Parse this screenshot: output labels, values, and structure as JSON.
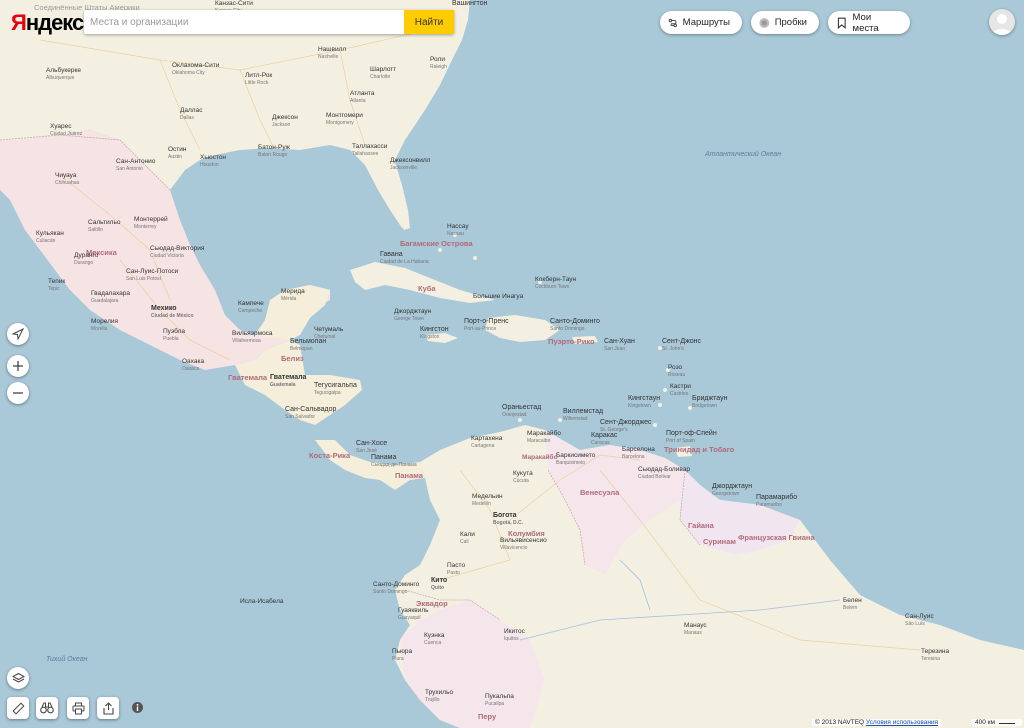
{
  "logo": {
    "first": "Я",
    "rest": "ндекс"
  },
  "search": {
    "placeholder": "Места и организации",
    "button": "Найти"
  },
  "toolbar": {
    "routes": "Маршруты",
    "traffic": "Пробки",
    "places": "Мои места"
  },
  "copyright": {
    "text": "© 2013 NAVTEQ",
    "link": "Условия использования"
  },
  "scale": {
    "label": "400 км"
  },
  "colors": {
    "sea": "#a9c8d8",
    "land": "#f5f1e3",
    "mexico": "#f6e4e4",
    "yellow": "#ffcc00",
    "accent": "#e8000f"
  },
  "icons": [
    "locate-arrow-icon",
    "zoom-in-icon",
    "zoom-out-icon",
    "layers-icon",
    "ruler-icon",
    "panorama-binoculars-icon",
    "print-icon",
    "share-icon",
    "info-icon",
    "route-icon",
    "traffic-icon",
    "bookmark-icon",
    "avatar-icon"
  ],
  "labels": {
    "usa": "Соединённые Штаты Америки",
    "kansas": "Канзас-Сити",
    "kansas_s": "Kansas City",
    "washington": "Вашингтон",
    "albuquerque": "Альбукерке",
    "albuquerque_s": "Albuquerque",
    "oklahoma": "Оклахома-Сити",
    "oklahoma_s": "Oklahoma City",
    "nashville": "Нашвилл",
    "nashville_s": "Nashville",
    "littlerock": "Литл-Рок",
    "littlerock_s": "Little Rock",
    "charlotte": "Шарлотт",
    "charlotte_s": "Charlotte",
    "raleigh": "Роли",
    "raleigh_s": "Raleigh",
    "atlanta": "Атланта",
    "atlanta_s": "Atlanta",
    "dallas": "Даллас",
    "dallas_s": "Dallas",
    "jackson": "Джексон",
    "jackson_s": "Jackson",
    "montgomery": "Монтгомери",
    "montgomery_s": "Montgomery",
    "juarez": "Хуарес",
    "juarez_s": "Ciudad Juárez",
    "batonrouge": "Батон-Руж",
    "batonrouge_s": "Baton Rouge",
    "austin": "Остин",
    "austin_s": "Austin",
    "tallahassee": "Таллахасси",
    "tallahassee_s": "Tallahassee",
    "sanantonio": "Сан-Антонио",
    "sanantonio_s": "San Antonio",
    "houston": "Хьюстон",
    "houston_s": "Houston",
    "jacksonville": "Джексонвилл",
    "jacksonville_s": "Jacksonville",
    "atlantic": "Атлантический Океан",
    "chihuahua": "Чиуауа",
    "chihuahua_s": "Chihuahua",
    "saltillo": "Сальтильо",
    "saltillo_s": "Saltillo",
    "monterrey": "Монтеррей",
    "monterrey_s": "Monterrey",
    "nassau": "Нассау",
    "nassau_s": "Nassau",
    "culiacan": "Кульякан",
    "culiacan_s": "Culiacán",
    "mexico_c": "Мексика",
    "victoria": "Сьюдад-Виктория",
    "victoria_s": "Ciudad Victoria",
    "bahamas": "Багамские Острова",
    "durango": "Дуранго",
    "durango_s": "Durango",
    "havana": "Гавана",
    "havana_s": "Ciudad de La Habana",
    "slp": "Сан-Луис-Потоси",
    "slp_s": "San Luis Potosí",
    "georgetown_c": "Джорджтаун",
    "cockburn": "Кокберн-Таун",
    "cockburn_s": "Cockburn Town",
    "tepic": "Тепик",
    "tepic_s": "Tepic",
    "cuba": "Куба",
    "guadalajara": "Гвадалахара",
    "guadalajara_s": "Guadalajara",
    "merida": "Мерида",
    "merida_s": "Mérida",
    "campeche": "Кампече",
    "campeche_s": "Campeche",
    "bahamas_b": "Большие Инагуа",
    "mexico": "Мехико",
    "mexico_s": "Ciudad de México",
    "georgetown_cay": "Джорджтаун",
    "georgetown_cay_s": "George Town",
    "portauprince": "Порт-о-Пренс",
    "portauprince_s": "Port-au-Prince",
    "santodomingo": "Санто-Доминго",
    "santodomingo_s": "Santo Domingo",
    "morelia": "Морелия",
    "morelia_s": "Morelia",
    "puebla": "Пуэбла",
    "puebla_s": "Puebla",
    "villahermosa": "Вильяэрмоса",
    "villahermosa_s": "Villahermosa",
    "chetumal": "Четумаль",
    "chetumal_s": "Chetumal",
    "kingston": "Кингстон",
    "kingston_s": "Kingston",
    "stjohns": "Сент-Джонс",
    "stjohns_s": "St. John's",
    "belmopan": "Бельмопан",
    "belmopan_s": "Belmopan",
    "puertorico": "Пуэрто-Рико",
    "sanjuan": "Сан-Хуан",
    "sanjuan_s": "San Juan",
    "oaxaca": "Оахака",
    "oaxaca_s": "Oaxaca",
    "belize": "Белиз",
    "roseau": "Розо",
    "roseau_s": "Roseau",
    "guatemala_c": "Гватемала",
    "guatemala": "Гватемала",
    "guatemala_s": "Guatemala",
    "tegucigalpa": "Тегусигальпа",
    "tegucigalpa_s": "Tegucigalpa",
    "castries": "Кастри",
    "castries_s": "Castries",
    "kingstown": "Кингстаун",
    "kingstown_s": "Kingstown",
    "bridgetown": "Бриджтаун",
    "bridgetown_s": "Bridgetown",
    "sansalvador": "Сан-Сальвадор",
    "sansalvador_s": "San Salvador",
    "oranjestad": "Ораньестад",
    "oranjestad_s": "Oranjestad",
    "willemstad": "Виллемстад",
    "willemstad_s": "Willemstad",
    "stgeorges": "Сент-Джорджес",
    "stgeorges_s": "St. George's",
    "portofspain": "Порт-оф-Спейн",
    "portofspain_s": "Port of Spain",
    "sanjose": "Сан-Хосе",
    "sanjose_s": "San José",
    "cartagena": "Картахена",
    "cartagena_s": "Cartagena",
    "maracaibo": "Маракайбо",
    "maracaibo_s": "Maracaibo",
    "caracas": "Каракас",
    "caracas_s": "Caracas",
    "barquisimeto": "Баркисимето",
    "barquisimeto_s": "Barquisimeto",
    "barcelona": "Барселона",
    "barcelona_s": "Barcelona",
    "trinidad": "Тринидад и Тобаго",
    "costarica": "Коста-Рика",
    "panama": "Панама",
    "panama_s": "Сьюдад-де-Панама",
    "panama_c": "Панама",
    "maracaibo_l": "Маракайбо",
    "cucuta": "Кукута",
    "cucuta_s": "Cúcuta",
    "ciudadbolivar": "Сьюдад-Боливар",
    "ciudadbolivar_s": "Ciudad Bolívar",
    "georgetown_g": "Джорджтаун",
    "georgetown_g_s": "Georgetown",
    "paramaribo": "Парамарибо",
    "paramaribo_s": "Paramaribo",
    "venezuela": "Венесуэла",
    "medellin": "Медельин",
    "medellin_s": "Medellín",
    "bogota": "Богота",
    "bogota_s": "Bogotá, D.C.",
    "colombia": "Колумбия",
    "villavicencio": "Вильявисенсио",
    "villavicencio_s": "Villavicencio",
    "guyana": "Гайана",
    "suriname": "Суринам",
    "frenchguiana": "Французская Гвиана",
    "cali": "Кали",
    "cali_s": "Cali",
    "pasto": "Пасто",
    "pasto_s": "Pasto",
    "santodomingo_e": "Санто-Доминго",
    "santodomingo_e_s": "Santo Domingo",
    "quito": "Кито",
    "quito_s": "Quito",
    "isabela": "Исла-Исабела",
    "ecuador": "Эквадор",
    "guayaquil": "Гуаяквиль",
    "guayaquil_s": "Guayaquil",
    "belem": "Белен",
    "belem_s": "Belém",
    "cuenca": "Куэнка",
    "cuenca_s": "Cuenca",
    "iquitos": "Икитос",
    "iquitos_s": "Iquitos",
    "manaus": "Манаус",
    "manaus_s": "Manaus",
    "sanluis": "Сан-Луис",
    "sanluis_s": "São Luís",
    "pacific": "Тихий Океан",
    "piura": "Пьюра",
    "piura_s": "Piura",
    "teresina": "Терезина",
    "teresina_s": "Teresina",
    "trujillo": "Трухильо",
    "trujillo_s": "Trujillo",
    "pucallpa": "Пукальпа",
    "pucallpa_s": "Pucallpa",
    "peru": "Перу"
  }
}
